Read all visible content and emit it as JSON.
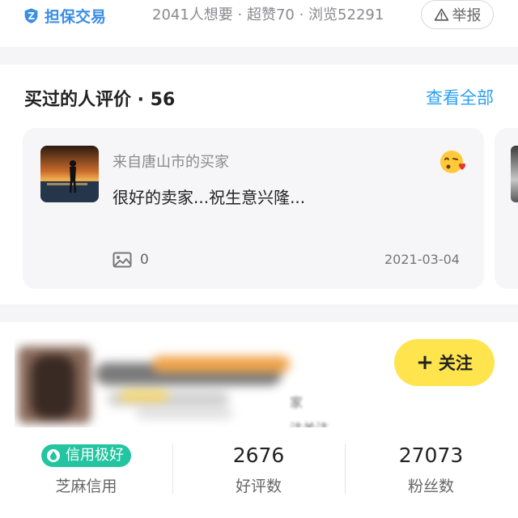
{
  "top": {
    "escrow_label": "担保交易",
    "stats": "2041人想要 · 超赞70 · 浏览52291",
    "report_label": "举报"
  },
  "reviews": {
    "title": "买过的人评价 · 56",
    "view_all": "查看全部",
    "cards": [
      {
        "buyer": "来自唐山市的买家",
        "comment": "很好的卖家...祝生意兴隆...",
        "image_count": "0",
        "date": "2021-03-04"
      }
    ]
  },
  "seller": {
    "tag_text": "家",
    "note_text": "注关注，...",
    "follow_label": "关注",
    "metrics": [
      {
        "value": "信用极好",
        "label": "芝麻信用"
      },
      {
        "value": "2676",
        "label": "好评数"
      },
      {
        "value": "27073",
        "label": "粉丝数"
      }
    ]
  },
  "colors": {
    "accent_blue": "#2a9ff0",
    "follow_yellow": "#ffe44d",
    "credit_green": "#23c4a0"
  },
  "icons": {
    "escrow": "shield-escrow-icon",
    "report": "warning-triangle-icon",
    "emoji": "kiss-heart-emoji-icon",
    "images": "image-icon",
    "credit": "water-drop-icon"
  }
}
